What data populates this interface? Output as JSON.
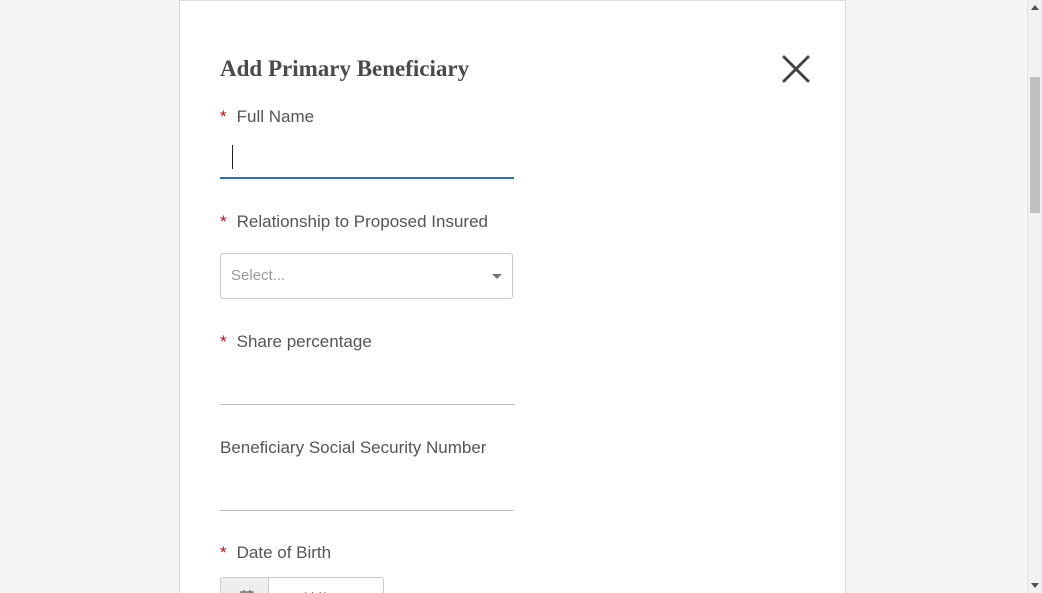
{
  "modal": {
    "title": "Add Primary Beneficiary"
  },
  "fields": {
    "full_name": {
      "label": "Full Name",
      "required_marker": "*",
      "value": ""
    },
    "relationship": {
      "label": "Relationship to Proposed Insured",
      "required_marker": "*",
      "placeholder": "Select..."
    },
    "share": {
      "label": "Share percentage",
      "required_marker": "*",
      "value": ""
    },
    "ssn": {
      "label": "Beneficiary Social Security Number",
      "value": ""
    },
    "dob": {
      "label": "Date of Birth",
      "required_marker": "*",
      "placeholder": "mm/dd/yyyy"
    }
  },
  "colors": {
    "required": "#d0021b",
    "focus": "#2a6fc9"
  },
  "icons": {
    "close": "close-icon",
    "calendar": "calendar-icon",
    "dropdown": "chevron-down-icon"
  }
}
